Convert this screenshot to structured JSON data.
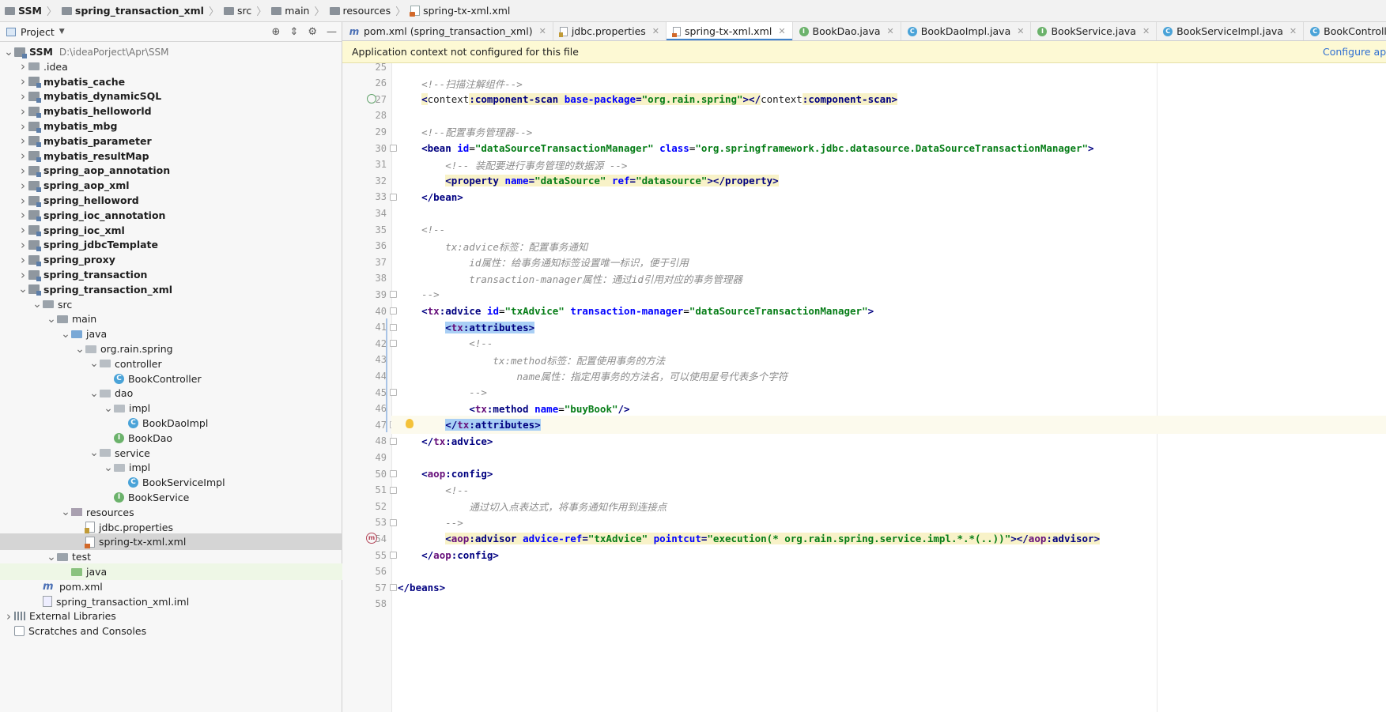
{
  "breadcrumb": [
    {
      "label": "SSM",
      "bold": true
    },
    {
      "label": "spring_transaction_xml",
      "bold": true
    },
    {
      "label": "src",
      "bold": false
    },
    {
      "label": "main",
      "bold": false
    },
    {
      "label": "resources",
      "bold": false
    },
    {
      "label": "spring-tx-xml.xml",
      "bold": false
    }
  ],
  "project": {
    "title": "Project",
    "tree": [
      {
        "label": "SSM",
        "path": "D:\\ideaPorject\\Apr\\SSM",
        "indent": 0,
        "arrow": "down",
        "icon": "mod",
        "bold": true
      },
      {
        "label": ".idea",
        "indent": 1,
        "arrow": "right",
        "icon": "folder"
      },
      {
        "label": "mybatis_cache",
        "indent": 1,
        "arrow": "right",
        "icon": "mod",
        "bold": true
      },
      {
        "label": "mybatis_dynamicSQL",
        "indent": 1,
        "arrow": "right",
        "icon": "mod",
        "bold": true
      },
      {
        "label": "mybatis_helloworld",
        "indent": 1,
        "arrow": "right",
        "icon": "mod",
        "bold": true
      },
      {
        "label": "mybatis_mbg",
        "indent": 1,
        "arrow": "right",
        "icon": "mod",
        "bold": true
      },
      {
        "label": "mybatis_parameter",
        "indent": 1,
        "arrow": "right",
        "icon": "mod",
        "bold": true
      },
      {
        "label": "mybatis_resultMap",
        "indent": 1,
        "arrow": "right",
        "icon": "mod",
        "bold": true
      },
      {
        "label": "spring_aop_annotation",
        "indent": 1,
        "arrow": "right",
        "icon": "mod",
        "bold": true
      },
      {
        "label": "spring_aop_xml",
        "indent": 1,
        "arrow": "right",
        "icon": "mod",
        "bold": true
      },
      {
        "label": "spring_helloword",
        "indent": 1,
        "arrow": "right",
        "icon": "mod",
        "bold": true
      },
      {
        "label": "spring_ioc_annotation",
        "indent": 1,
        "arrow": "right",
        "icon": "mod",
        "bold": true
      },
      {
        "label": "spring_ioc_xml",
        "indent": 1,
        "arrow": "right",
        "icon": "mod",
        "bold": true
      },
      {
        "label": "spring_jdbcTemplate",
        "indent": 1,
        "arrow": "right",
        "icon": "mod",
        "bold": true
      },
      {
        "label": "spring_proxy",
        "indent": 1,
        "arrow": "right",
        "icon": "mod",
        "bold": true
      },
      {
        "label": "spring_transaction",
        "indent": 1,
        "arrow": "right",
        "icon": "mod",
        "bold": true
      },
      {
        "label": "spring_transaction_xml",
        "indent": 1,
        "arrow": "down",
        "icon": "mod",
        "bold": true
      },
      {
        "label": "src",
        "indent": 2,
        "arrow": "down",
        "icon": "folder"
      },
      {
        "label": "main",
        "indent": 3,
        "arrow": "down",
        "icon": "folder"
      },
      {
        "label": "java",
        "indent": 4,
        "arrow": "down",
        "icon": "folder-src"
      },
      {
        "label": "org.rain.spring",
        "indent": 5,
        "arrow": "down",
        "icon": "pkg"
      },
      {
        "label": "controller",
        "indent": 6,
        "arrow": "down",
        "icon": "pkg"
      },
      {
        "label": "BookController",
        "indent": 7,
        "arrow": "none",
        "icon": "class"
      },
      {
        "label": "dao",
        "indent": 6,
        "arrow": "down",
        "icon": "pkg"
      },
      {
        "label": "impl",
        "indent": 7,
        "arrow": "down",
        "icon": "pkg"
      },
      {
        "label": "BookDaoImpl",
        "indent": 8,
        "arrow": "none",
        "icon": "class"
      },
      {
        "label": "BookDao",
        "indent": 7,
        "arrow": "none",
        "icon": "interface"
      },
      {
        "label": "service",
        "indent": 6,
        "arrow": "down",
        "icon": "pkg"
      },
      {
        "label": "impl",
        "indent": 7,
        "arrow": "down",
        "icon": "pkg"
      },
      {
        "label": "BookServiceImpl",
        "indent": 8,
        "arrow": "none",
        "icon": "class"
      },
      {
        "label": "BookService",
        "indent": 7,
        "arrow": "none",
        "icon": "interface"
      },
      {
        "label": "resources",
        "indent": 4,
        "arrow": "down",
        "icon": "res"
      },
      {
        "label": "jdbc.properties",
        "indent": 5,
        "arrow": "none",
        "icon": "props"
      },
      {
        "label": "spring-tx-xml.xml",
        "indent": 5,
        "arrow": "none",
        "icon": "xml",
        "selected": true
      },
      {
        "label": "test",
        "indent": 3,
        "arrow": "down",
        "icon": "folder"
      },
      {
        "label": "java",
        "indent": 4,
        "arrow": "none",
        "icon": "folder-test",
        "highlight": true
      },
      {
        "label": "pom.xml",
        "indent": 2,
        "arrow": "none",
        "icon": "maven"
      },
      {
        "label": "spring_transaction_xml.iml",
        "indent": 2,
        "arrow": "none",
        "icon": "iml"
      },
      {
        "label": "External Libraries",
        "indent": 0,
        "arrow": "right",
        "icon": "lib"
      },
      {
        "label": "Scratches and Consoles",
        "indent": 0,
        "arrow": "none",
        "icon": "scratch"
      }
    ]
  },
  "tabs": [
    {
      "label": "pom.xml (spring_transaction_xml)",
      "icon": "maven",
      "active": false
    },
    {
      "label": "jdbc.properties",
      "icon": "props",
      "active": false
    },
    {
      "label": "spring-tx-xml.xml",
      "icon": "xml",
      "active": true
    },
    {
      "label": "BookDao.java",
      "icon": "interface",
      "active": false
    },
    {
      "label": "BookDaoImpl.java",
      "icon": "class",
      "active": false
    },
    {
      "label": "BookService.java",
      "icon": "interface",
      "active": false
    },
    {
      "label": "BookServiceImpl.java",
      "icon": "class",
      "active": false
    },
    {
      "label": "BookController.java",
      "icon": "class",
      "active": false
    }
  ],
  "banner": {
    "message": "Application context not configured for this file",
    "action": "Configure app"
  },
  "editor": {
    "first_line": 25,
    "current_line": 47,
    "lines": [
      [],
      [
        [
          "cm",
          "    <!--扫描注解组件-->"
        ]
      ],
      [
        [
          "p",
          "    "
        ],
        [
          "ty",
          "<"
        ],
        [
          "pre",
          "context"
        ],
        [
          "ty",
          ":component-scan "
        ],
        [
          "at",
          "base-package"
        ],
        [
          "ty",
          "="
        ],
        [
          "va",
          "\"org.rain.spring\""
        ],
        [
          "ty",
          "></"
        ],
        [
          "pre",
          "context"
        ],
        [
          "ty",
          ":component-scan>"
        ]
      ],
      [],
      [
        [
          "cm",
          "    <!--配置事务管理器-->"
        ]
      ],
      [
        [
          "p",
          "    "
        ],
        [
          "t",
          "<bean "
        ],
        [
          "a",
          "id"
        ],
        [
          "p",
          "="
        ],
        [
          "v",
          "\"dataSourceTransactionManager\""
        ],
        [
          "p",
          " "
        ],
        [
          "a",
          "class"
        ],
        [
          "p",
          "="
        ],
        [
          "v",
          "\"org.springframework.jdbc.datasource.DataSourceTransactionManager\""
        ],
        [
          "t",
          ">"
        ]
      ],
      [
        [
          "cm",
          "        <!-- 装配要进行事务管理的数据源 -->"
        ]
      ],
      [
        [
          "p",
          "        "
        ],
        [
          "ty",
          "<property "
        ],
        [
          "at",
          "name"
        ],
        [
          "ty",
          "="
        ],
        [
          "va",
          "\"dataSource\""
        ],
        [
          "ty",
          " "
        ],
        [
          "at",
          "ref"
        ],
        [
          "ty",
          "="
        ],
        [
          "va",
          "\"datasource\""
        ],
        [
          "ty",
          "></property>"
        ]
      ],
      [
        [
          "p",
          "    "
        ],
        [
          "t",
          "</bean>"
        ]
      ],
      [],
      [
        [
          "cm",
          "    <!--"
        ]
      ],
      [
        [
          "cm",
          "        tx:advice标签：配置事务通知"
        ]
      ],
      [
        [
          "cm",
          "            id属性：给事务通知标签设置唯一标识，便于引用"
        ]
      ],
      [
        [
          "cm",
          "            transaction-manager属性：通过id引用对应的事务管理器"
        ]
      ],
      [
        [
          "cm",
          "    -->"
        ]
      ],
      [
        [
          "p",
          "    "
        ],
        [
          "t",
          "<"
        ],
        [
          "pr",
          "tx"
        ],
        [
          "t",
          ":advice "
        ],
        [
          "a",
          "id"
        ],
        [
          "p",
          "="
        ],
        [
          "v",
          "\"txAdvice\""
        ],
        [
          "p",
          " "
        ],
        [
          "a",
          "transaction-manager"
        ],
        [
          "p",
          "="
        ],
        [
          "v",
          "\"dataSourceTransactionManager\""
        ],
        [
          "t",
          ">"
        ]
      ],
      [
        [
          "p",
          "        "
        ],
        [
          "tb",
          "<"
        ],
        [
          "prb",
          "tx"
        ],
        [
          "tb",
          ":attributes>"
        ]
      ],
      [
        [
          "cm",
          "            <!--"
        ]
      ],
      [
        [
          "cm",
          "                tx:method标签：配置使用事务的方法"
        ]
      ],
      [
        [
          "cm",
          "                    name属性：指定用事务的方法名，可以使用星号代表多个字符"
        ]
      ],
      [
        [
          "cm",
          "            -->"
        ]
      ],
      [
        [
          "p",
          "            "
        ],
        [
          "t",
          "<"
        ],
        [
          "pr",
          "tx"
        ],
        [
          "t",
          ":method "
        ],
        [
          "a",
          "name"
        ],
        [
          "p",
          "="
        ],
        [
          "v",
          "\"buyBook\""
        ],
        [
          "t",
          "/>"
        ]
      ],
      [
        [
          "p",
          "        "
        ],
        [
          "tb",
          "</"
        ],
        [
          "prb",
          "tx"
        ],
        [
          "tb",
          ":attributes>"
        ]
      ],
      [
        [
          "p",
          "    "
        ],
        [
          "t",
          "</"
        ],
        [
          "pr",
          "tx"
        ],
        [
          "t",
          ":advice>"
        ]
      ],
      [],
      [
        [
          "p",
          "    "
        ],
        [
          "t",
          "<"
        ],
        [
          "pr",
          "aop"
        ],
        [
          "t",
          ":config>"
        ]
      ],
      [
        [
          "cm",
          "        <!--"
        ]
      ],
      [
        [
          "cm",
          "            通过切入点表达式，将事务通知作用到连接点"
        ]
      ],
      [
        [
          "cm",
          "        -->"
        ]
      ],
      [
        [
          "p",
          "        "
        ],
        [
          "ty",
          "<"
        ],
        [
          "pry",
          "aop"
        ],
        [
          "ty",
          ":advisor "
        ],
        [
          "at",
          "advice-ref"
        ],
        [
          "ty",
          "="
        ],
        [
          "va",
          "\"txAdvice\""
        ],
        [
          "ty",
          " "
        ],
        [
          "at",
          "pointcut"
        ],
        [
          "ty",
          "="
        ],
        [
          "va",
          "\"execution(* org.rain.spring.service.impl.*.*(..))\""
        ],
        [
          "ty",
          "></"
        ],
        [
          "pry",
          "aop"
        ],
        [
          "ty",
          ":advisor>"
        ]
      ],
      [
        [
          "p",
          "    "
        ],
        [
          "t",
          "</"
        ],
        [
          "pr",
          "aop"
        ],
        [
          "t",
          ":config>"
        ]
      ],
      [],
      [
        [
          "t",
          "</beans>"
        ]
      ],
      []
    ]
  }
}
